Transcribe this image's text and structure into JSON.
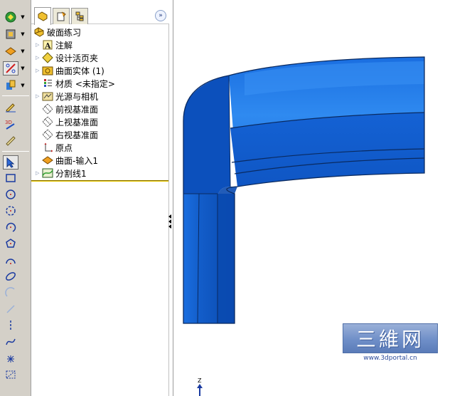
{
  "feature_tree": {
    "root_label": "破面练习",
    "items": [
      {
        "label": "注解",
        "icon": "annotation-icon"
      },
      {
        "label": "设计活页夹",
        "icon": "design-binder-icon"
      },
      {
        "label": "曲面实体 (1)",
        "icon": "surface-bodies-icon"
      },
      {
        "label": "材质 <未指定>",
        "icon": "material-icon"
      },
      {
        "label": "光源与相机",
        "icon": "lights-cameras-icon"
      },
      {
        "label": "前视基准面",
        "icon": "plane-icon"
      },
      {
        "label": "上视基准面",
        "icon": "plane-icon"
      },
      {
        "label": "右视基准面",
        "icon": "plane-icon"
      },
      {
        "label": "原点",
        "icon": "origin-icon"
      },
      {
        "label": "曲面-输入1",
        "icon": "imported-surface-icon"
      },
      {
        "label": "分割线1",
        "icon": "split-line-icon"
      }
    ]
  },
  "tabs": [
    "feature-manager-tab",
    "property-manager-tab",
    "configuration-manager-tab"
  ],
  "toolbar_icons": [
    "view-orientation-icon",
    "display-style-icon",
    "hide-show-icon",
    "sketch-tools-icon",
    "section-view-icon",
    "edit-sketch-icon",
    "3d-sketch-icon",
    "smart-dimension-icon",
    "select-icon",
    "rectangle-icon",
    "circle-icon",
    "perimeter-circle-icon",
    "centerpoint-arc-icon",
    "polygon-icon",
    "tangent-arc-icon",
    "ellipse-icon",
    "3point-arc-icon",
    "line-icon",
    "centerline-icon",
    "spline-icon",
    "point-icon",
    "construction-geometry-icon"
  ],
  "watermark": {
    "title": "三維网",
    "url": "www.3dportal.cn"
  },
  "triad_axis": "Z",
  "colors": {
    "surface_main": "#1060d8",
    "surface_dark": "#0a4ab0",
    "surface_light": "#2a86f0",
    "edge": "#0a2a60",
    "toolbar_bg": "#d4d0c8",
    "rollback_bar": "#e6c800"
  }
}
